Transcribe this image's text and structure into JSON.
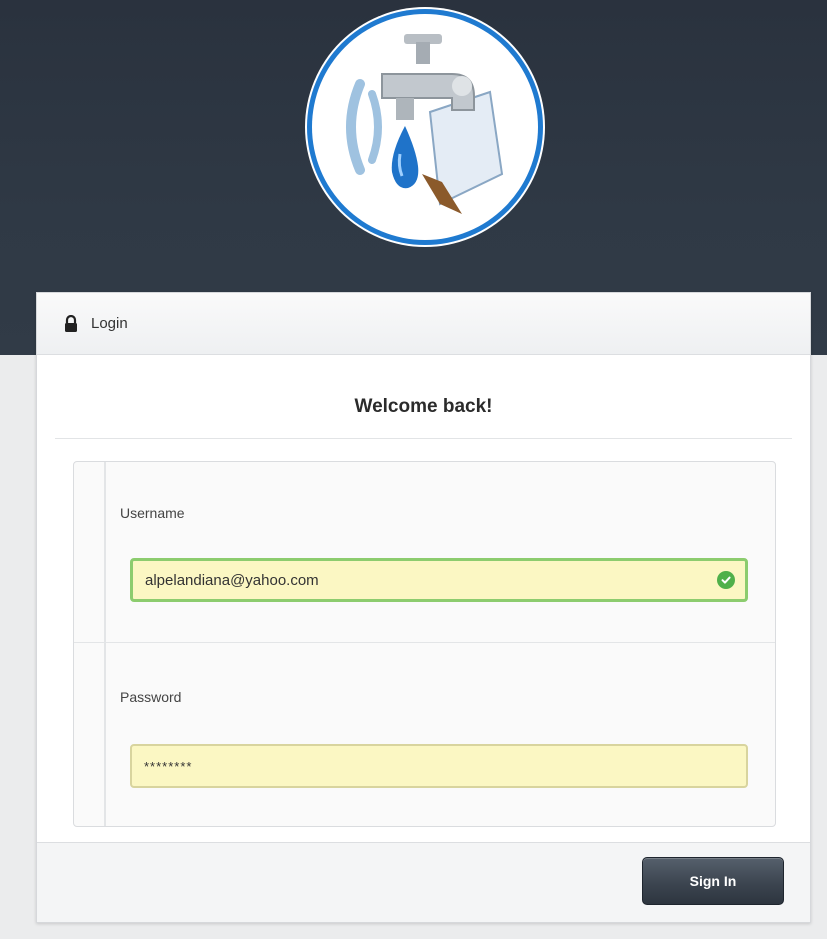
{
  "panel": {
    "title": "Login",
    "icon": "lock-icon"
  },
  "welcome": "Welcome back!",
  "form": {
    "username_label": "Username",
    "username_value": "alpelandiana@yahoo.com",
    "password_label": "Password",
    "password_value": "********",
    "username_status_icon": "check-icon"
  },
  "actions": {
    "submit_label": "Sign In"
  },
  "colors": {
    "header_dark": "#2f3945",
    "field_fill": "#fbf7c3",
    "valid_border": "#8ccc6e",
    "check": "#4fb04a",
    "logo_ring": "#1f7ad0"
  }
}
